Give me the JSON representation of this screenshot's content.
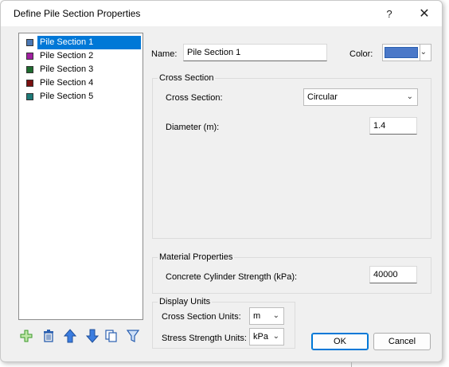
{
  "window": {
    "title": "Define Pile Section Properties",
    "help_label": "?",
    "close_label": "✕"
  },
  "sections": [
    {
      "label": "Pile Section 1",
      "color": "#4a78b5",
      "selected": true
    },
    {
      "label": "Pile Section 2",
      "color": "#a020a0",
      "selected": false
    },
    {
      "label": "Pile Section 3",
      "color": "#1e6b2e",
      "selected": false
    },
    {
      "label": "Pile Section 4",
      "color": "#7a1010",
      "selected": false
    },
    {
      "label": "Pile Section 5",
      "color": "#1e7a78",
      "selected": false
    }
  ],
  "toolbar": {
    "icons": [
      "add-icon",
      "delete-icon",
      "move-up-icon",
      "move-down-icon",
      "copy-icon",
      "filter-icon"
    ]
  },
  "form": {
    "name_label": "Name:",
    "name_value": "Pile Section 1",
    "color_label": "Color:",
    "color_value": "#4a78c8"
  },
  "cross_section": {
    "group_title": "Cross Section",
    "type_label": "Cross Section:",
    "type_value": "Circular",
    "diameter_label": "Diameter (m):",
    "diameter_value": "1.4"
  },
  "material": {
    "group_title": "Material Properties",
    "strength_label": "Concrete Cylinder Strength (kPa):",
    "strength_value": "40000"
  },
  "units": {
    "group_title": "Display Units",
    "cross_label": "Cross Section Units:",
    "cross_value": "m",
    "stress_label": "Stress Strength Units:",
    "stress_value": "kPa"
  },
  "buttons": {
    "ok_label": "OK",
    "cancel_label": "Cancel"
  }
}
